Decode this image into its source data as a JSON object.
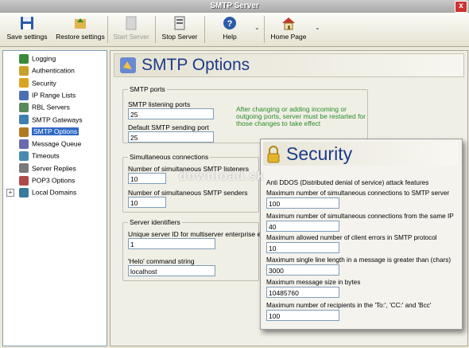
{
  "window": {
    "title": "SMTP Server",
    "close_glyph": "x"
  },
  "toolbar": {
    "save": "Save settings",
    "restore": "Restore settings",
    "start": "Start Server",
    "stop": "Stop Server",
    "help": "Help",
    "home": "Home Page",
    "dropdown_glyph": "⌄"
  },
  "tree": {
    "items": [
      {
        "label": "Logging",
        "icon": "log-icon",
        "color": "#3a8a3a"
      },
      {
        "label": "Authentication",
        "icon": "key-icon",
        "color": "#c8a02a"
      },
      {
        "label": "Security",
        "icon": "lock-icon",
        "color": "#d9a520"
      },
      {
        "label": "IP Range Lists",
        "icon": "list-icon",
        "color": "#4a6fb5"
      },
      {
        "label": "RBL Servers",
        "icon": "server-icon",
        "color": "#5a8a5a"
      },
      {
        "label": "SMTP Gateways",
        "icon": "gateway-icon",
        "color": "#3f7fb0"
      },
      {
        "label": "SMTP Options",
        "icon": "options-icon",
        "color": "#b07a20"
      },
      {
        "label": "Message Queue",
        "icon": "queue-icon",
        "color": "#6a6ab0"
      },
      {
        "label": "Timeouts",
        "icon": "clock-icon",
        "color": "#4a8ab0"
      },
      {
        "label": "Server Replies",
        "icon": "reply-icon",
        "color": "#7a7a7a"
      },
      {
        "label": "POP3 Options",
        "icon": "mailbox-icon",
        "color": "#b04a4a"
      },
      {
        "label": "Local Domains",
        "icon": "domain-icon",
        "color": "#3a7a9a"
      }
    ],
    "selected": "SMTP Options",
    "expander": "+"
  },
  "header": {
    "title": "SMTP Options"
  },
  "smtp_ports": {
    "group": "SMTP ports",
    "listen_label": "SMTP listening ports",
    "listen_value": "25",
    "send_label": "Default SMTP sending port",
    "send_value": "25",
    "hint_1": "After changing or adding incoming or",
    "hint_2": "outgoing ports, server must be restarted for",
    "hint_3": "those changes to take effect"
  },
  "connections": {
    "group": "Simultaneous connections",
    "listeners_label": "Number of simultaneous SMTP listeners",
    "listeners_value": "10",
    "senders_label": "Number of simultaneous SMTP senders",
    "senders_value": "10"
  },
  "identifiers": {
    "group": "Server identifiers",
    "uid_label": "Unique server ID for multiserver enterprise en",
    "uid_value": "1",
    "hello_label": "'Helo' command string",
    "hello_value": "localhost"
  },
  "security": {
    "title": "Security",
    "section": "Anti DDOS (Distributed denial of service) attack features",
    "f1_label": "Maximum number of simultaneous connections to SMTP server",
    "f1_value": "100",
    "f2_label": "Maximum number of simultaneous connections from the same IP",
    "f2_value": "40",
    "f3_label": "Maximum allowed number of client errors in SMTP protocol",
    "f3_value": "10",
    "f4_label": "Maximum single line length in a message is greater than (chars)",
    "f4_value": "3000",
    "f5_label": "Maximum message size in bytes",
    "f5_value": "10485760",
    "f6_label": "Maximum number of recipients in the 'To:', 'CC:' and 'Bcc'",
    "f6_value": "100"
  },
  "watermark": "download.sk"
}
